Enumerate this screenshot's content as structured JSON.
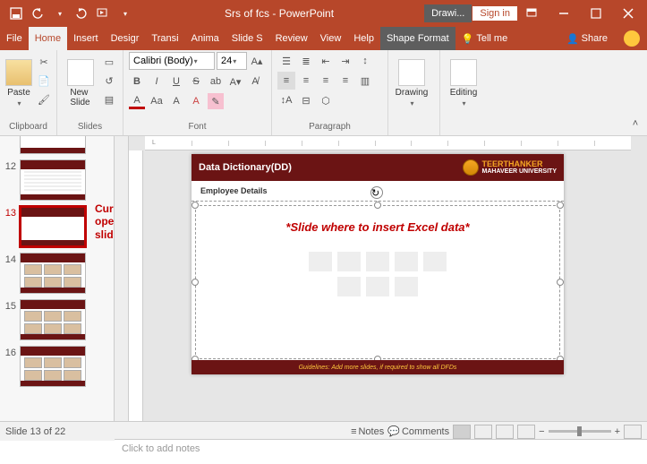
{
  "titlebar": {
    "doc_title": "Srs of fcs - PowerPoint",
    "drawing_tools": "Drawi...",
    "sign_in": "Sign in"
  },
  "tabs": {
    "file": "File",
    "home": "Home",
    "insert": "Insert",
    "design": "Desigr",
    "transitions": "Transi",
    "animations": "Anima",
    "slideshow": "Slide S",
    "review": "Review",
    "view": "View",
    "help": "Help",
    "shape_format": "Shape Format",
    "tell_me": "Tell me",
    "share": "Share"
  },
  "ribbon": {
    "clipboard": {
      "label": "Clipboard",
      "paste": "Paste"
    },
    "slides": {
      "label": "Slides",
      "new_slide": "New\nSlide"
    },
    "font": {
      "label": "Font",
      "name": "Calibri (Body)",
      "size": "24"
    },
    "paragraph": {
      "label": "Paragraph"
    },
    "drawing": {
      "label": "Drawing"
    },
    "editing": {
      "label": "Editing"
    }
  },
  "thumbs": {
    "nums": [
      "12",
      "13",
      "14",
      "15",
      "16"
    ],
    "annot": "Currently\nopened\nslide"
  },
  "slide": {
    "title": "Data Dictionary(DD)",
    "uni1": "TEERTHANKER",
    "uni2": "MAHAVEER UNIVERSITY",
    "subtitle": "Employee Details",
    "body_annot": "*Slide where to insert Excel data*",
    "footer": "Guidelines: Add more slides, if required to show all DFDs"
  },
  "notes": {
    "placeholder": "Click to add notes"
  },
  "status": {
    "slide": "Slide 13 of 22",
    "notes": "Notes",
    "comments": "Comments"
  }
}
